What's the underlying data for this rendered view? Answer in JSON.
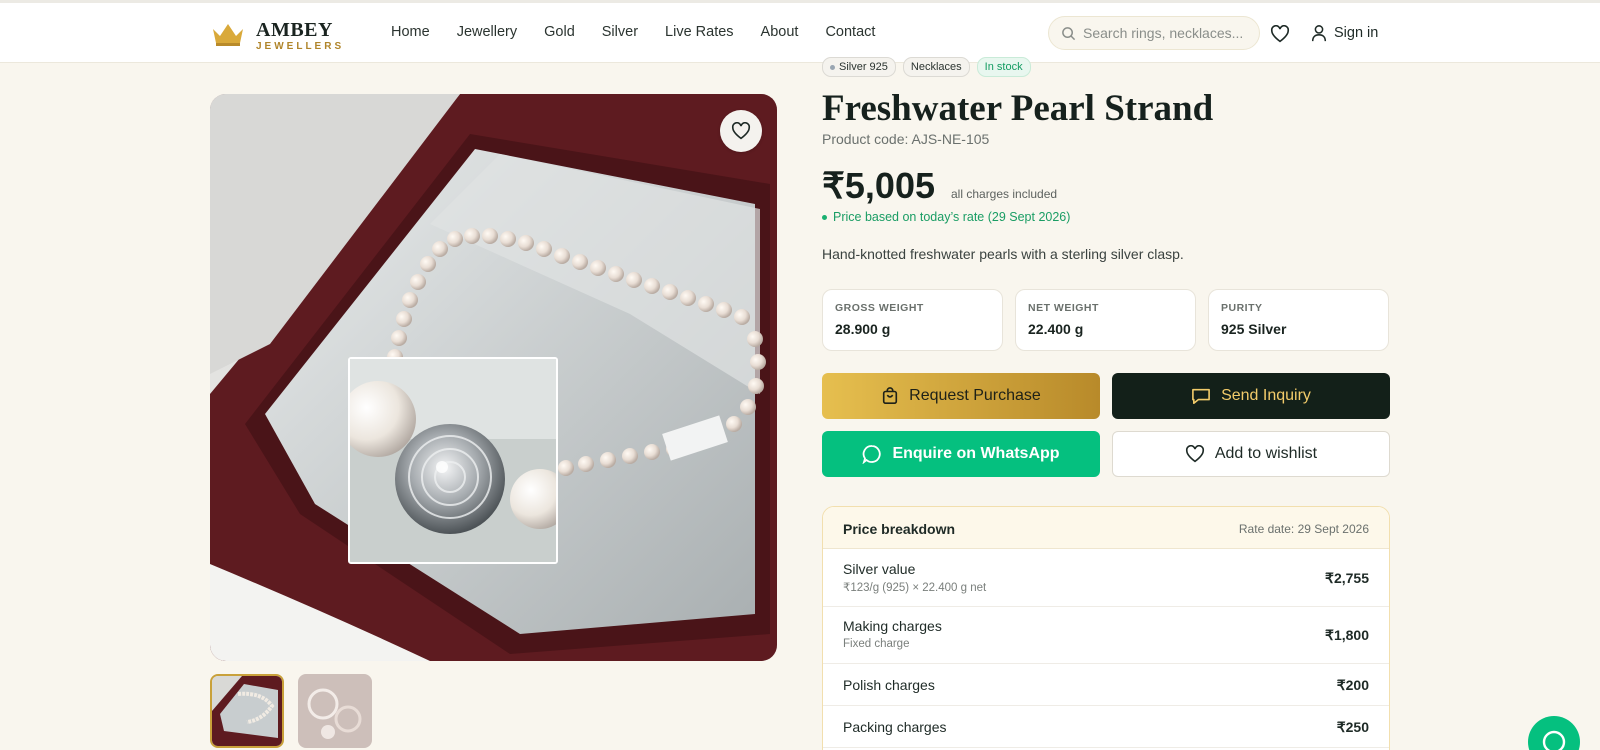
{
  "brand": {
    "name": "AMBEY",
    "tagline": "JEWELLERS"
  },
  "nav": {
    "items": [
      "Home",
      "Jewellery",
      "Gold",
      "Silver",
      "Live Rates",
      "About",
      "Contact"
    ]
  },
  "search": {
    "placeholder": "Search rings, necklaces..."
  },
  "header": {
    "signin_label": "Sign in",
    "icons": [
      "search-icon",
      "heart-icon",
      "user-icon"
    ]
  },
  "product": {
    "tags": [
      "Silver 925",
      "Necklaces",
      "In stock"
    ],
    "title": "Freshwater Pearl Strand",
    "code": "Product code: AJS-NE-105",
    "price": "₹5,005",
    "price_note": "all charges included",
    "rate_note": "Price based on today’s rate (29 Sept 2026)",
    "description": "Hand-knotted freshwater pearls with a sterling silver clasp.",
    "specs": [
      {
        "label": "GROSS WEIGHT",
        "value": "28.900 g"
      },
      {
        "label": "NET WEIGHT",
        "value": "22.400 g"
      },
      {
        "label": "PURITY",
        "value": "925 Silver"
      }
    ]
  },
  "actions": {
    "request_purchase": "Request Purchase",
    "send_inquiry": "Send Inquiry",
    "whatsapp": "Enquire on WhatsApp",
    "wishlist": "Add to wishlist"
  },
  "breakdown": {
    "title": "Price breakdown",
    "rate_date": "Rate date: 29 Sept 2026",
    "rows": [
      {
        "name": "Silver value",
        "sub": "₹123/g (925) × 22.400 g net",
        "amount": "₹2,755"
      },
      {
        "name": "Making charges",
        "sub": "Fixed charge",
        "amount": "₹1,800"
      },
      {
        "name": "Polish charges",
        "sub": "",
        "amount": "₹200"
      },
      {
        "name": "Packing charges",
        "sub": "",
        "amount": "₹250"
      }
    ]
  },
  "colors": {
    "accent_gold": "#c9a13a",
    "whatsapp_green": "#05c07f",
    "dark": "#132019",
    "background": "#f9f6ee"
  }
}
